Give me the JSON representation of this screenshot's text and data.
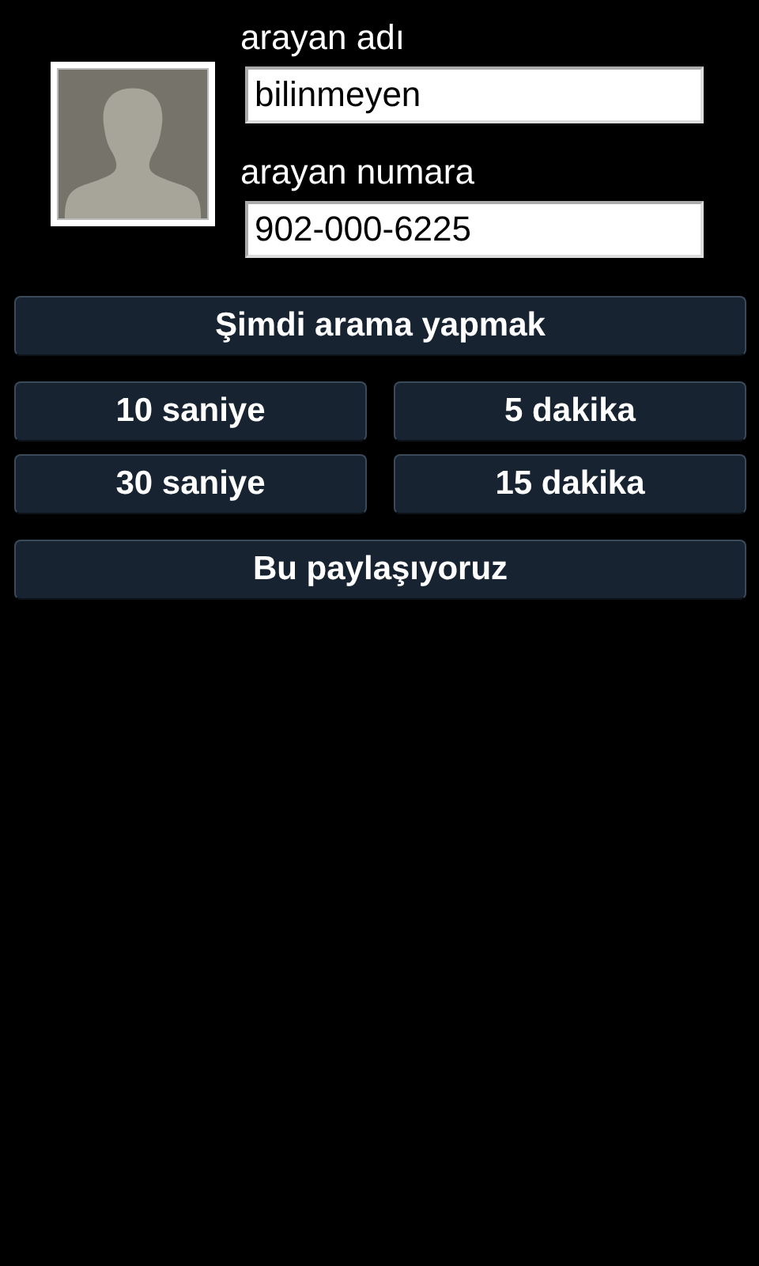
{
  "caller_name": {
    "label": "arayan adı",
    "value": "bilinmeyen"
  },
  "caller_number": {
    "label": "arayan numara",
    "value": "902-000-6225"
  },
  "call_now_button": "Şimdi arama yapmak",
  "delay_buttons": [
    "10 saniye",
    "5 dakika",
    "30 saniye",
    "15 dakika"
  ],
  "share_button": "Bu paylaşıyoruz"
}
